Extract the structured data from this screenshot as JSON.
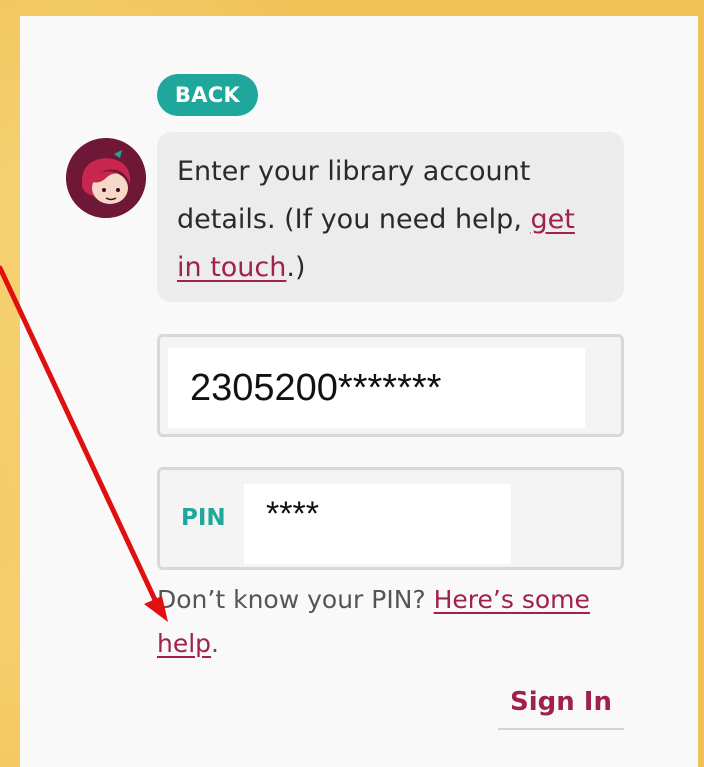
{
  "nav": {
    "back_label": "BACK"
  },
  "message": {
    "text_before": "Enter your library account details. (If you need help, ",
    "link_text": "get in touch",
    "text_after": ".)"
  },
  "card_field": {
    "value": "2305200*******"
  },
  "pin_field": {
    "label": "PIN",
    "value": "****"
  },
  "help": {
    "prefix": "Don’t know your PIN? ",
    "link_text": "Here’s some help",
    "suffix": "."
  },
  "actions": {
    "sign_in_label": "Sign In"
  },
  "colors": {
    "accent_teal": "#1ea79a",
    "link_maroon": "#a0214f",
    "annotation_arrow": "#e01010"
  }
}
